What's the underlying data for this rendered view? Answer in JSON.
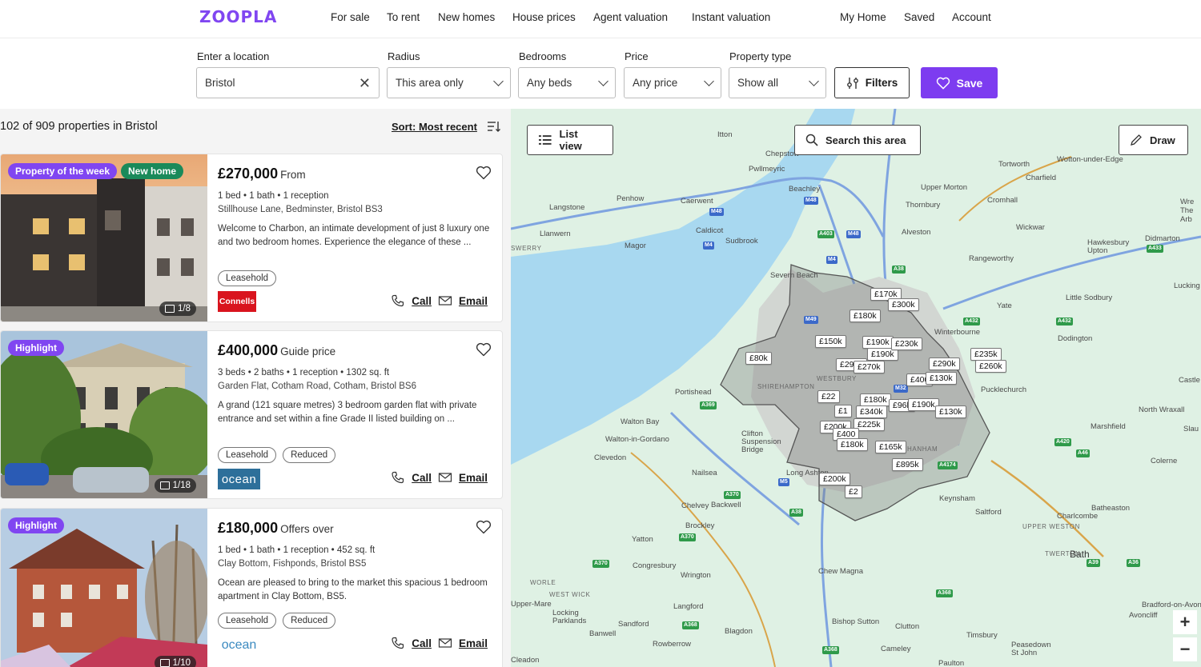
{
  "brand": {
    "logo": "ZOOPLA",
    "accent": "#7d3cf0"
  },
  "nav": {
    "links": [
      "For sale",
      "To rent",
      "New homes",
      "House prices",
      "Agent valuation",
      "Instant valuation"
    ],
    "right": [
      "My Home",
      "Saved",
      "Account"
    ]
  },
  "search": {
    "location_label": "Enter a location",
    "location_value": "Bristol",
    "radius_label": "Radius",
    "radius_value": "This area only",
    "bedrooms_label": "Bedrooms",
    "bedrooms_value": "Any beds",
    "price_label": "Price",
    "price_value": "Any price",
    "type_label": "Property type",
    "type_value": "Show all",
    "filters_label": "Filters",
    "save_label": "Save"
  },
  "results": {
    "summary": "102 of 909 properties in Bristol",
    "sort_label": "Sort: Most recent"
  },
  "listings": [
    {
      "badges": [
        "Property of the week",
        "New home"
      ],
      "image_count": "1/8",
      "price": "£270,000",
      "price_qualifier": "From",
      "specs": "1 bed • 1 bath • 1 reception",
      "address": "Stillhouse Lane, Bedminster, Bristol BS3",
      "description": "Welcome to Charbon, an intimate development of just 8 luxury one and two bedroom homes. Experience the elegance of these ...",
      "tags": [
        "Leasehold"
      ],
      "agent": "Connells",
      "call_label": "Call",
      "email_label": "Email"
    },
    {
      "badges": [
        "Highlight"
      ],
      "image_count": "1/18",
      "price": "£400,000",
      "price_qualifier": "Guide price",
      "specs": "3 beds • 2 baths • 1 reception • 1302 sq. ft",
      "address": "Garden Flat, Cotham Road, Cotham, Bristol BS6",
      "description": "A grand (121 square metres) 3 bedroom garden flat with private entrance and set within a fine Grade II listed building on ...",
      "tags": [
        "Leasehold",
        "Reduced"
      ],
      "agent": "ocean",
      "call_label": "Call",
      "email_label": "Email"
    },
    {
      "badges": [
        "Highlight"
      ],
      "image_count": "1/10",
      "price": "£180,000",
      "price_qualifier": "Offers over",
      "specs": "1 bed • 1 bath • 1 reception • 452 sq. ft",
      "address": "Clay Bottom, Fishponds, Bristol BS5",
      "description": "Ocean are pleased to bring to the market this spacious 1 bedroom apartment in Clay Bottom, BS5.",
      "tags": [
        "Leasehold",
        "Reduced"
      ],
      "agent": "ocean",
      "call_label": "Call",
      "email_label": "Email"
    }
  ],
  "map": {
    "list_view_label": "List view",
    "search_area_label": "Search this area",
    "draw_label": "Draw",
    "zoom_in": "+",
    "zoom_out": "−",
    "places": [
      "Itton",
      "Chepstow",
      "Pwllmeyric",
      "Tortworth",
      "Wotton-under-Edge",
      "Charfield",
      "Penhow",
      "Caerwent",
      "Beachley",
      "Upper Morton",
      "Thornbury",
      "Cromhall",
      "Langstone",
      "Llanwern",
      "Caldicot",
      "Sudbrook",
      "Magor",
      "Alveston",
      "Wickwar",
      "Hawkesbury Upton",
      "Didmarton",
      "Rangeworthy",
      "Severn Beach",
      "Little Sodbury",
      "Yate",
      "Winterbourne",
      "Dodington",
      "Pucklechurch",
      "Portishead",
      "Walton Bay",
      "Walton-in-Gordano",
      "Clevedon",
      "Clifton Suspension Bridge",
      "Nailsea",
      "Long Ashton",
      "Keynsham",
      "Saltford",
      "Marshfield",
      "North Wraxall",
      "Colerne",
      "Batheaston",
      "Charlcombe",
      "Bath",
      "Chelvey",
      "Backwell",
      "Brockley",
      "Yatton",
      "Congresbury",
      "Wrington",
      "Chew Magna",
      "Langford",
      "Locking Parklands",
      "Sandford",
      "Banwell",
      "Blagdon",
      "Bishop Sutton",
      "Clutton",
      "Rowberrow",
      "Cameley",
      "Timsbury",
      "Peasedown St John",
      "Paulton",
      "Bradford-on-Avon",
      "Avoncliff",
      "Cleadon",
      "Upper-Mare",
      "Lucking",
      "Castle",
      "Slau",
      "Wre The Arb"
    ],
    "price_pins": [
      "£170k",
      "£300k",
      "£180k",
      "£150k",
      "£190k",
      "£190k",
      "£230k",
      "£80k",
      "£270k",
      "£290k",
      "£235k",
      "£260k",
      "£130k",
      "£340k",
      "£190k",
      "£96k",
      "£225k",
      "£180k",
      "£165k",
      "£895k",
      "£200k",
      "£2",
      "£22",
      "£400",
      "£1"
    ]
  }
}
